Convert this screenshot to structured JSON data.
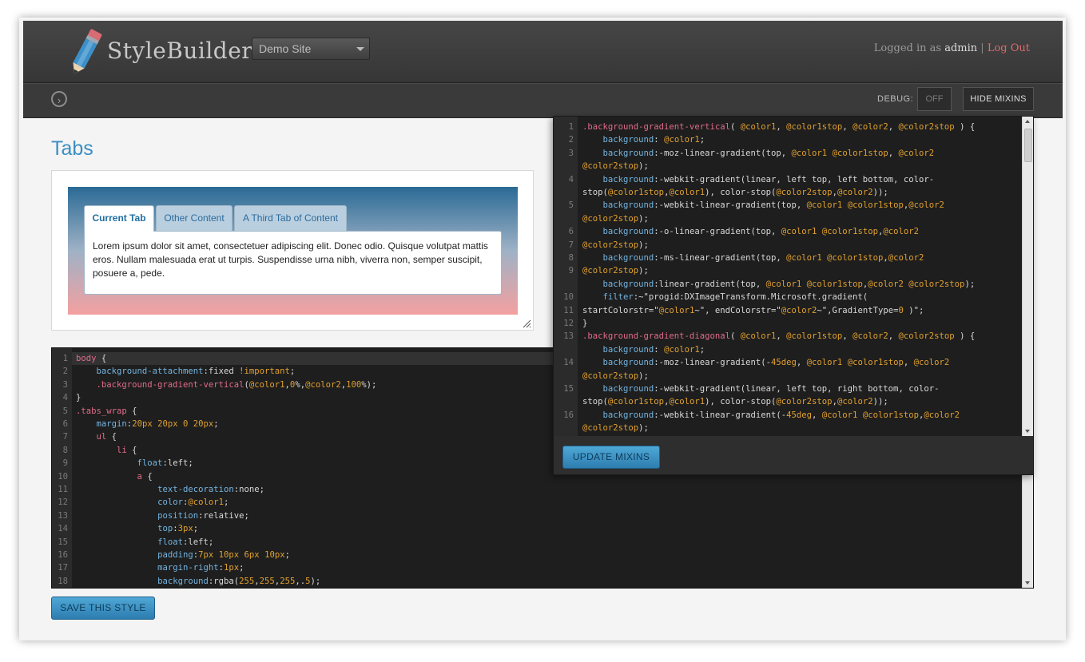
{
  "app": {
    "brand": "StyleBuilder",
    "site_select": "Demo Site",
    "login_prefix": "Logged in as",
    "username": "admin",
    "separator": "|",
    "logout": "Log Out"
  },
  "toolbar": {
    "debug_label": "DEBUG:",
    "debug_value": "OFF",
    "hide_mixins": "HIDE MIXINS",
    "toggle_icon": "chevron-right-circle-icon"
  },
  "main": {
    "title": "Tabs",
    "save_button": "SAVE THIS STYLE"
  },
  "preview": {
    "tabs": [
      "Current Tab",
      "Other Content",
      "A Third Tab of Content"
    ],
    "content": "Lorem ipsum dolor sit amet, consectetuer adipiscing elit. Donec odio. Quisque volutpat mattis eros. Nullam malesuada erat ut turpis. Suspendisse urna nibh, viverra non, semper suscipit, posuere a, pede."
  },
  "style_editor": {
    "line_numbers": [
      "1",
      "2",
      "3",
      "4",
      "5",
      "6",
      "7",
      "8",
      "9",
      "10",
      "11",
      "12",
      "13",
      "14",
      "15",
      "16",
      "17",
      "18"
    ],
    "lines": [
      "body {",
      "    background-attachment:fixed !important;",
      "    .background-gradient-vertical(@color1,0%,@color2,100%);",
      "}",
      ".tabs_wrap {",
      "    margin:20px 20px 0 20px;",
      "    ul {",
      "        li {",
      "            float:left;",
      "            a {",
      "                text-decoration:none;",
      "                color:@color1;",
      "                position:relative;",
      "                top:3px;",
      "                float:left;",
      "                padding:7px 10px 6px 10px;",
      "                margin-right:1px;",
      "                background:rgba(255,255,255,.5);"
    ]
  },
  "mixins": {
    "update_button": "UPDATE MIXINS",
    "rows": [
      {
        "n": "1",
        "text": ".background-gradient-vertical( @color1, @color1stop, @color2, @color2stop ) {"
      },
      {
        "n": "2",
        "text": "    background: @color1;"
      },
      {
        "n": "3",
        "text": "    background:-moz-linear-gradient(top, @color1 @color1stop, @color2"
      },
      {
        "n": "",
        "text": "@color2stop);"
      },
      {
        "n": "4",
        "text": "    background:-webkit-gradient(linear, left top, left bottom, color-"
      },
      {
        "n": "",
        "text": "stop(@color1stop,@color1), color-stop(@color2stop,@color2));"
      },
      {
        "n": "5",
        "text": "    background:-webkit-linear-gradient(top, @color1 @color1stop,@color2"
      },
      {
        "n": "",
        "text": "@color2stop);"
      },
      {
        "n": "6",
        "text": "    background:-o-linear-gradient(top, @color1 @color1stop,@color2"
      },
      {
        "n": "7",
        "text": "@color2stop);"
      },
      {
        "n": "8",
        "text": "    background:-ms-linear-gradient(top, @color1 @color1stop,@color2"
      },
      {
        "n": "9",
        "text": "@color2stop);"
      },
      {
        "n": "",
        "text": "    background:linear-gradient(top, @color1 @color1stop,@color2 @color2stop);"
      },
      {
        "n": "10",
        "text": "    filter:~\"progid:DXImageTransform.Microsoft.gradient("
      },
      {
        "n": "11",
        "text": "startColorstr=\"@color1~\", endColorstr=\"@color2~\",GradientType=0 )\";"
      },
      {
        "n": "12",
        "text": "}"
      },
      {
        "n": "13",
        "text": ".background-gradient-diagonal( @color1, @color1stop, @color2, @color2stop ) {"
      },
      {
        "n": "",
        "text": "    background: @color1;"
      },
      {
        "n": "14",
        "text": "    background:-moz-linear-gradient(-45deg, @color1 @color1stop, @color2"
      },
      {
        "n": "",
        "text": "@color2stop);"
      },
      {
        "n": "15",
        "text": "    background:-webkit-gradient(linear, left top, right bottom, color-"
      },
      {
        "n": "",
        "text": "stop(@color1stop,@color1), color-stop(@color2stop,@color2));"
      },
      {
        "n": "16",
        "text": "    background:-webkit-linear-gradient(-45deg, @color1 @color1stop,@color2"
      },
      {
        "n": "",
        "text": "@color2stop);"
      }
    ]
  },
  "colors": {
    "accent": "#3b8ec2",
    "topbar": "#3c3c3c",
    "logout": "#e26a6a",
    "button": "#3a8fc3"
  }
}
